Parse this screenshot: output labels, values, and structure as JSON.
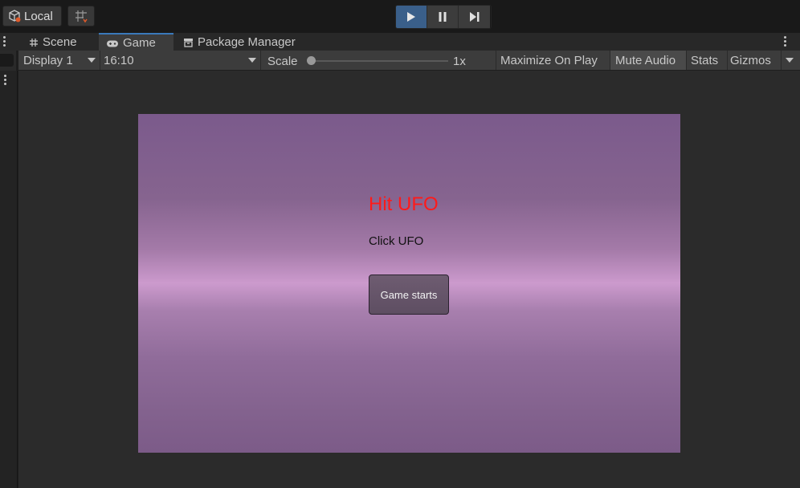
{
  "toolbar": {
    "local_label": "Local",
    "icons": {
      "local": "cube-cloud-icon",
      "grid": "grid-snap-icon",
      "play": "play-icon",
      "pause": "pause-icon",
      "step": "step-icon"
    },
    "play_active": true
  },
  "tabs": [
    {
      "label": "Scene",
      "icon": "hash-icon"
    },
    {
      "label": "Game",
      "icon": "gamepad-icon",
      "active": true
    },
    {
      "label": "Package Manager",
      "icon": "package-icon"
    }
  ],
  "game_toolbar": {
    "display": "Display 1",
    "aspect": "16:10",
    "scale_label": "Scale",
    "scale_value": "1x",
    "scale_level": 0,
    "maximize_on_play": "Maximize On Play",
    "mute_audio": "Mute Audio",
    "stats": "Stats",
    "gizmos": "Gizmos"
  },
  "game": {
    "title": "Hit UFO",
    "subtitle": "Click UFO",
    "button": "Game starts",
    "colors": {
      "title": "#ff1a1a",
      "sky_top": "#7b5a8c",
      "horizon": "#cc9acd"
    }
  },
  "colors": {
    "accent": "#3a79bb",
    "play_active": "#3a5f8a"
  }
}
